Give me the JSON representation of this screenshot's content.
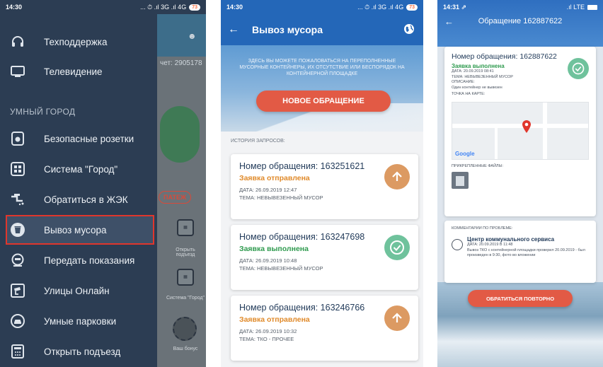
{
  "screen1": {
    "status": {
      "time": "14:30",
      "indicators": "... ⏱ .ıl 3G .ıl 4G",
      "battery": "73"
    },
    "background": {
      "account": "чет: 2905178",
      "pay_button": "ПАТЕЖ",
      "tile_caption_1": "Открыть подъезд",
      "tile_caption_2": "Система \"Город\"",
      "bonus": "Ваш бонус"
    },
    "menu_top": [
      {
        "label": "Техподдержка",
        "icon": "headset-icon"
      },
      {
        "label": "Телевидение",
        "icon": "tv-icon"
      }
    ],
    "section_title": "УМНЫЙ ГОРОД",
    "menu_city": [
      {
        "label": "Безопасные розетки",
        "icon": "socket-icon"
      },
      {
        "label": "Система \"Город\"",
        "icon": "city-system-icon"
      },
      {
        "label": "Обратиться в ЖЭК",
        "icon": "plumbing-icon"
      },
      {
        "label": "Вывоз мусора",
        "icon": "trash-icon",
        "active": true
      },
      {
        "label": "Передать показания",
        "icon": "meter-icon"
      },
      {
        "label": "Улицы Онлайн",
        "icon": "camera-icon"
      },
      {
        "label": "Умные парковки",
        "icon": "car-icon"
      },
      {
        "label": "Открыть подъезд",
        "icon": "intercom-icon"
      }
    ]
  },
  "screen2": {
    "status": {
      "time": "14:30",
      "indicators": "... ⏱ .ıl 3G .ıl 4G",
      "battery": "73"
    },
    "title": "Вывоз мусора",
    "info": "ЗДЕСЬ ВЫ МОЖЕТЕ ПОЖАЛОВАТЬСЯ НА ПЕРЕПОЛНЕННЫЕ МУСОРНЫЕ КОНТЕЙНЕРЫ, ИХ ОТСУТСТВИЕ ИЛИ БЕСПОРЯДОК НА КОНТЕЙНЕРНОЙ ПЛОЩАДКЕ",
    "new_button": "НОВОЕ ОБРАЩЕНИЕ",
    "history_title": "ИСТОРИЯ ЗАПРОСОВ:",
    "requests": [
      {
        "number": "Номер обращения: 163251621",
        "status": "Заявка отправлена",
        "status_kind": "sent",
        "date": "ДАТА: 26.09.2019 12:47",
        "topic": "ТЕМА: НЕВЫВЕЗЕННЫЙ МУСОР"
      },
      {
        "number": "Номер обращения: 163247698",
        "status": "Заявка выполнена",
        "status_kind": "done",
        "date": "ДАТА: 26.09.2019 10:48",
        "topic": "ТЕМА: НЕВЫВЕЗЕННЫЙ МУСОР"
      },
      {
        "number": "Номер обращения: 163246766",
        "status": "Заявка отправлена",
        "status_kind": "sent",
        "date": "ДАТА: 26.09.2019 10:32",
        "topic": "ТЕМА: ТКО - ПРОЧЕЕ"
      }
    ]
  },
  "screen3": {
    "status": {
      "time": "14:31 ⇗",
      "indicators": ".ıl LTE"
    },
    "title": "Обращение 162887622",
    "number": "Номер обращения: 162887622",
    "status_text": "Заявка выполнена",
    "date": "ДАТА: 20.09.2019 08:41",
    "topic": "ТЕМА: НЕВЫВЕЗЕННЫЙ МУСОР",
    "description_label": "ОПИСАНИЕ:",
    "description": "Один контейнер не вывезен",
    "map_label": "ТОЧКА НА КАРТЕ:",
    "map_logo": "Google",
    "files_label": "ПРИКРЕПЛЕННЫЕ ФАЙЛЫ:",
    "comments_label": "КОММЕНТАРИИ ПО ПРОБЛЕМЕ:",
    "comment_author": "Центр коммунального сервиса",
    "comment_date": "ДАТА: 20.09.2019 в 11:48",
    "comment_text": "Вывоз ТКО с контейнерной площадки проверил 20.09.2019 - был произведен в 9:30, фото во вложении",
    "again_button": "ОБРАТИТЬСЯ ПОВТОРНО"
  },
  "colors": {
    "drawer": "#2c3d53",
    "appbar": "#2467b8",
    "accent_red": "#e25a45",
    "sent": "#e08a2a",
    "done": "#2e9a4e",
    "highlight": "#e0362c"
  }
}
